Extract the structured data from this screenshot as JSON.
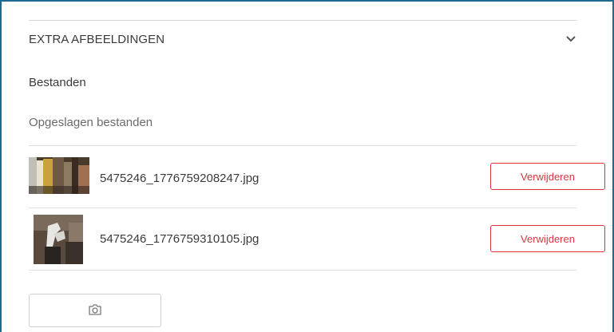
{
  "section": {
    "title": "EXTRA AFBEELDINGEN",
    "expand_icon": "chevron-down-icon"
  },
  "files_label": "Bestanden",
  "saved_files_label": "Opgeslagen bestanden",
  "saved_files": [
    {
      "thumbnail": "photo-thumbnail",
      "name": "5475246_1776759208247.jpg",
      "remove_label": "Verwijderen"
    },
    {
      "thumbnail": "photo-thumbnail",
      "name": "5475246_1776759310105.jpg",
      "remove_label": "Verwijderen"
    }
  ],
  "upload_button": {
    "icon": "camera-icon"
  },
  "colors": {
    "accent_border": "#1f6a92",
    "danger": "#d9363e",
    "divider": "#e2e2e2"
  }
}
